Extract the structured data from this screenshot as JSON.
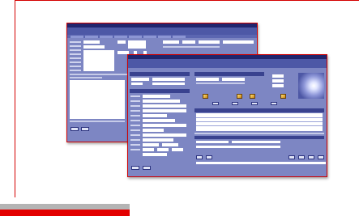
{
  "screen1": {
    "window_title": "",
    "app_name": "",
    "tab_count": 8
  },
  "screen2": {
    "window_title": "",
    "app_name": "",
    "section1_title": "",
    "section2_title": "",
    "section3_title": ""
  },
  "colors": {
    "frame": "#d40000",
    "accent_bar": "#e30000",
    "gray_bar": "#b4b4b4",
    "window_body": "#7d86c3",
    "window_header": "#4d58a6",
    "window_titlebar": "#20256e"
  }
}
